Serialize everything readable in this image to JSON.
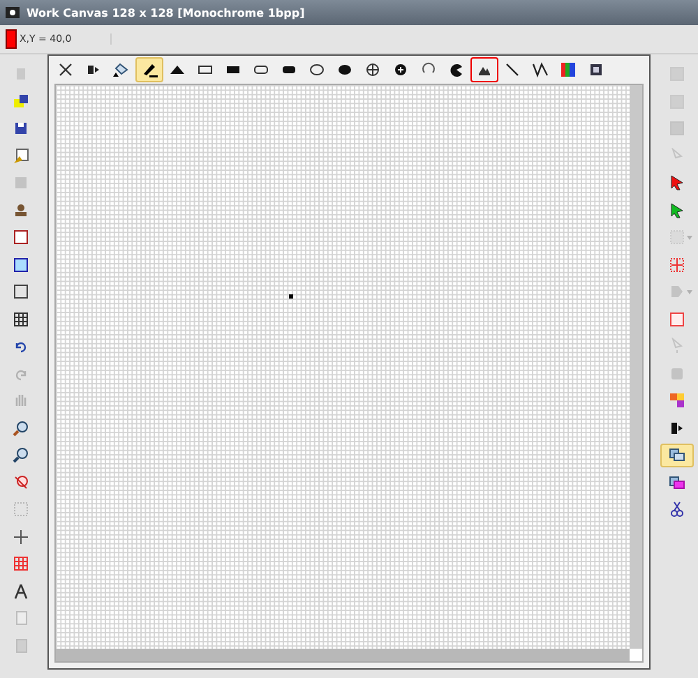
{
  "window": {
    "title": "Work Canvas 128 x 128 [Monochrome 1bpp]"
  },
  "status_bar": {
    "color": "#ff0000",
    "coordinates": "X,Y = 40,0"
  },
  "drawing_tools": [
    {
      "selected": false,
      "outlined": false
    },
    {
      "selected": false,
      "outlined": false
    },
    {
      "selected": false,
      "outlined": false
    },
    {
      "selected": true,
      "outlined": false
    },
    {
      "selected": false,
      "outlined": false
    },
    {
      "selected": false,
      "outlined": false
    },
    {
      "selected": false,
      "outlined": false
    },
    {
      "selected": false,
      "outlined": false
    },
    {
      "selected": false,
      "outlined": false
    },
    {
      "selected": false,
      "outlined": false
    },
    {
      "selected": false,
      "outlined": false
    },
    {
      "selected": false,
      "outlined": false
    },
    {
      "selected": false,
      "outlined": false
    },
    {
      "selected": false,
      "outlined": false
    },
    {
      "selected": false,
      "outlined": false
    },
    {
      "selected": false,
      "outlined": true
    },
    {
      "selected": false,
      "outlined": false
    },
    {
      "selected": false,
      "outlined": false
    },
    {
      "selected": false,
      "outlined": false
    },
    {
      "selected": false,
      "outlined": false
    }
  ],
  "left_toolbar": [
    {
      "disabled": true
    },
    {
      "disabled": false
    },
    {
      "disabled": false
    },
    {
      "disabled": false
    },
    {
      "disabled": true
    },
    {
      "disabled": false
    },
    {
      "disabled": false
    },
    {
      "disabled": false
    },
    {
      "disabled": false
    },
    {
      "disabled": false
    },
    {
      "disabled": false
    },
    {
      "disabled": true
    },
    {
      "disabled": true
    },
    {
      "disabled": false
    },
    {
      "disabled": false
    },
    {
      "disabled": false
    },
    {
      "disabled": true
    },
    {
      "disabled": false
    },
    {
      "disabled": false
    },
    {
      "disabled": false
    },
    {
      "disabled": true
    },
    {
      "disabled": true
    }
  ],
  "right_toolbar": [
    {
      "disabled": true,
      "selected": false,
      "dropdown": false
    },
    {
      "disabled": true,
      "selected": false,
      "dropdown": false
    },
    {
      "disabled": true,
      "selected": false,
      "dropdown": false
    },
    {
      "disabled": true,
      "selected": false,
      "dropdown": false
    },
    {
      "disabled": false,
      "selected": false,
      "dropdown": false
    },
    {
      "disabled": false,
      "selected": false,
      "dropdown": false
    },
    {
      "disabled": true,
      "selected": false,
      "dropdown": true
    },
    {
      "disabled": false,
      "selected": false,
      "dropdown": false
    },
    {
      "disabled": true,
      "selected": false,
      "dropdown": true
    },
    {
      "disabled": false,
      "selected": false,
      "dropdown": false
    },
    {
      "disabled": true,
      "selected": false,
      "dropdown": false
    },
    {
      "disabled": true,
      "selected": false,
      "dropdown": false
    },
    {
      "disabled": false,
      "selected": false,
      "dropdown": false
    },
    {
      "disabled": false,
      "selected": false,
      "dropdown": false
    },
    {
      "disabled": false,
      "selected": true,
      "dropdown": false
    },
    {
      "disabled": false,
      "selected": false,
      "dropdown": false
    },
    {
      "disabled": false,
      "selected": false,
      "dropdown": false
    }
  ]
}
